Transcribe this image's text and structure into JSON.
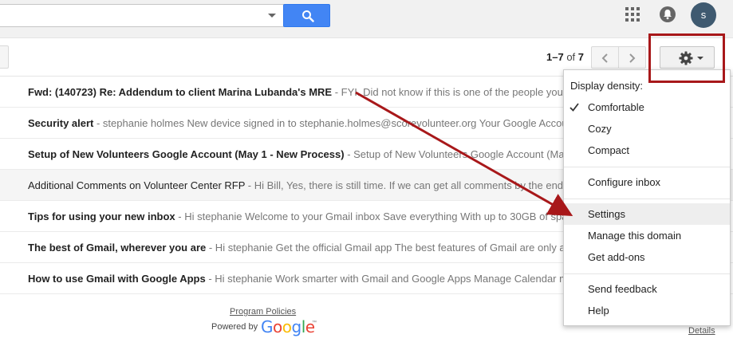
{
  "header": {
    "search": {
      "placeholder": "",
      "value": ""
    },
    "avatar_initial": "s"
  },
  "toolbar": {
    "pager": {
      "range": "1–7",
      "of_label": "of",
      "total": "7"
    }
  },
  "messages": [
    {
      "subject": "Fwd: (140723) Re: Addendum to client Marina Lubanda's MRE",
      "snippet": " - FYI. Did not know if this is one of the people you",
      "unread": true
    },
    {
      "subject": "Security alert",
      "snippet": " - stephanie holmes New device signed in to stephanie.holmes@scorevolunteer.org Your Google Account",
      "unread": true
    },
    {
      "subject": "Setup of New Volunteers Google Account (May 1 - New Process)",
      "snippet": " - Setup of New Volunteers Google Account (May",
      "unread": true
    },
    {
      "subject": "Additional Comments on Volunteer Center RFP",
      "snippet": " - Hi Bill, Yes, there is still time. If we can get all comments by the end o",
      "unread": false
    },
    {
      "subject": "Tips for using your new inbox",
      "snippet": " - Hi stephanie Welcome to your Gmail inbox Save everything With up to 30GB of space",
      "unread": true
    },
    {
      "subject": "The best of Gmail, wherever you are",
      "snippet": " - Hi stephanie Get the official Gmail app The best features of Gmail are only av",
      "unread": true
    },
    {
      "subject": "How to use Gmail with Google Apps",
      "snippet": " - Hi stephanie Work smarter with Gmail and Google Apps Manage Calendar me",
      "unread": true
    }
  ],
  "footer": {
    "program_policies": "Program Policies",
    "powered_by": "Powered by",
    "google_logo": [
      "G",
      "o",
      "o",
      "g",
      "l",
      "e"
    ],
    "trademark": "™",
    "details": "Details"
  },
  "settings_menu": {
    "density_heading": "Display density:",
    "items": {
      "comfortable": "Comfortable",
      "cozy": "Cozy",
      "compact": "Compact",
      "configure_inbox": "Configure inbox",
      "settings": "Settings",
      "manage_domain": "Manage this domain",
      "get_addons": "Get add-ons",
      "send_feedback": "Send feedback",
      "help": "Help"
    },
    "selected_density": "Comfortable",
    "highlighted_item": "Settings"
  },
  "colors": {
    "search_button": "#4285f4",
    "annotation_red": "#a8181a",
    "google_blue": "#4285f4",
    "google_red": "#ea4335",
    "google_yellow": "#fbbc05",
    "google_green": "#34a853"
  },
  "icons": {
    "search": "search-icon",
    "apps": "apps-grid-icon",
    "notifications": "notifications-icon",
    "prev": "chevron-left-icon",
    "next": "chevron-right-icon",
    "settings": "gear-icon",
    "check": "checkmark-icon"
  }
}
